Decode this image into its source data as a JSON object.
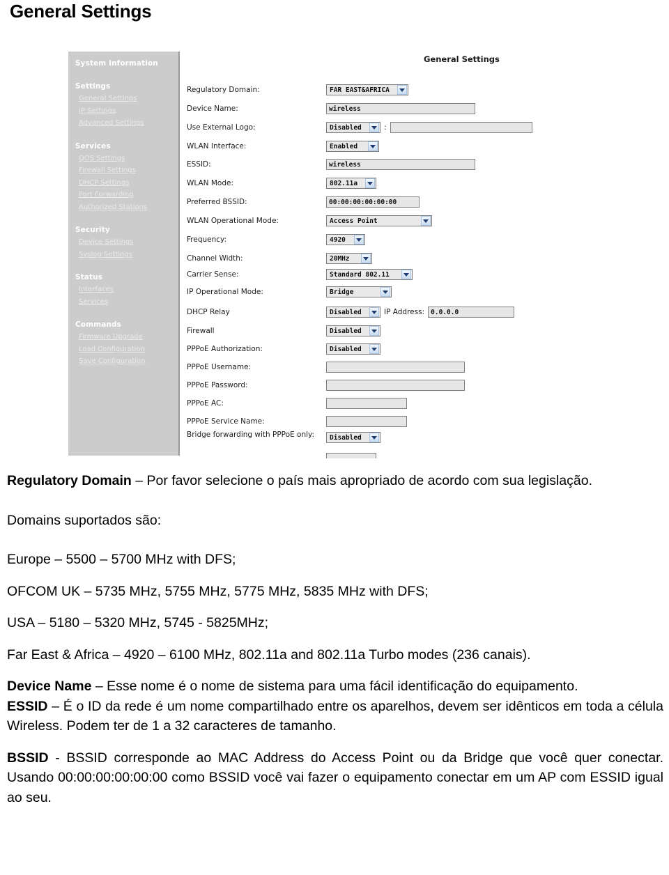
{
  "page_title": "General Settings",
  "router_ui": {
    "panel_title": "General Settings",
    "sidebar": {
      "groups": [
        {
          "title": "System Information",
          "items": []
        },
        {
          "title": "Settings",
          "items": [
            "General Settings",
            "IP Settings",
            "Advanced Settings"
          ]
        },
        {
          "title": "Services",
          "items": [
            "QOS Settings",
            "Firewall Settings",
            "DHCP Settings",
            "Port Forwarding",
            "Authorized Stations"
          ]
        },
        {
          "title": "Security",
          "items": [
            "Device Settings",
            "Syslog Settings"
          ]
        },
        {
          "title": "Status",
          "items": [
            "Interfaces",
            "Services"
          ]
        },
        {
          "title": "Commands",
          "items": [
            "Firmware Upgrade",
            "Load Configuration",
            "Save Configuration"
          ]
        }
      ]
    },
    "fields": {
      "regulatory_domain": {
        "label": "Regulatory Domain:",
        "value": "FAR EAST&AFRICA",
        "type": "select"
      },
      "device_name": {
        "label": "Device Name:",
        "value": "wireless",
        "type": "text"
      },
      "use_external_logo": {
        "label": "Use External Logo:",
        "value": "Disabled",
        "type": "select",
        "separator": ":",
        "extra_value": ""
      },
      "wlan_interface": {
        "label": "WLAN Interface:",
        "value": "Enabled",
        "type": "select"
      },
      "essid": {
        "label": "ESSID:",
        "value": "wireless",
        "type": "text"
      },
      "wlan_mode": {
        "label": "WLAN Mode:",
        "value": "802.11a",
        "type": "select"
      },
      "preferred_bssid": {
        "label": "Preferred BSSID:",
        "value": "00:00:00:00:00:00",
        "type": "text"
      },
      "wlan_operational_mode": {
        "label": "WLAN Operational Mode:",
        "value": "Access Point",
        "type": "select"
      },
      "frequency": {
        "label": "Frequency:",
        "value": "4920",
        "type": "select"
      },
      "channel_width": {
        "label": "Channel Width:",
        "value": "20MHz",
        "type": "select"
      },
      "carrier_sense": {
        "label": "Carrier Sense:",
        "value": "Standard 802.11",
        "type": "select"
      },
      "ip_operational_mode": {
        "label": "IP Operational Mode:",
        "value": "Bridge",
        "type": "select"
      },
      "dhcp_relay": {
        "label": "DHCP Relay",
        "value": "Disabled",
        "type": "select",
        "inline_label": "IP Address:",
        "ip_value": "0.0.0.0"
      },
      "firewall": {
        "label": "Firewall",
        "value": "Disabled",
        "type": "select"
      },
      "pppoe_authorization": {
        "label": "PPPoE Authorization:",
        "value": "Disabled",
        "type": "select"
      },
      "pppoe_username": {
        "label": "PPPoE Username:",
        "value": "",
        "type": "text"
      },
      "pppoe_password": {
        "label": "PPPoE Password:",
        "value": "",
        "type": "text"
      },
      "pppoe_ac": {
        "label": "PPPoE AC:",
        "value": "",
        "type": "text"
      },
      "pppoe_service_name": {
        "label": "PPPoE Service Name:",
        "value": "",
        "type": "text"
      },
      "bridge_forwarding": {
        "label": "Bridge forwarding with PPPoE only:",
        "value": "Disabled",
        "type": "select"
      }
    }
  },
  "body": {
    "p1_bold": "Regulatory Domain",
    "p1_rest": " – Por favor selecione o país mais apropriado de acordo com sua legislação.",
    "p2": "Domains suportados são:",
    "p3": "Europe – 5500 – 5700 MHz with DFS;",
    "p4": "OFCOM UK – 5735 MHz, 5755 MHz, 5775 MHz, 5835 MHz with DFS;",
    "p5": "USA – 5180 – 5320 MHz, 5745 - 5825MHz;",
    "p6": "Far East & Africa – 4920 – 6100 MHz, 802.11a and 802.11a Turbo modes (236 canais).",
    "p7_bold": "Device Name",
    "p7_rest": " – Esse nome é o nome de sistema para uma fácil identificação do equipamento.",
    "p8_bold": "ESSID",
    "p8_rest": " – É o ID da rede é um nome compartilhado entre os aparelhos, devem ser idênticos em toda a célula Wireless. Podem ter de 1 a 32 caracteres de tamanho.",
    "p9_bold": "BSSID",
    "p9_rest": " - BSSID corresponde ao MAC Address do Access Point ou da  Bridge que você quer conectar. Usando 00:00:00:00:00:00 como BSSID você vai fazer o equipamento conectar em um AP com ESSID igual ao seu."
  },
  "colors": {
    "sidebar_bg": "#cccccc",
    "sidebar_link": "#eaeaea",
    "input_bg": "#e6e6e6",
    "select_arrow": "#c9dcf2"
  }
}
